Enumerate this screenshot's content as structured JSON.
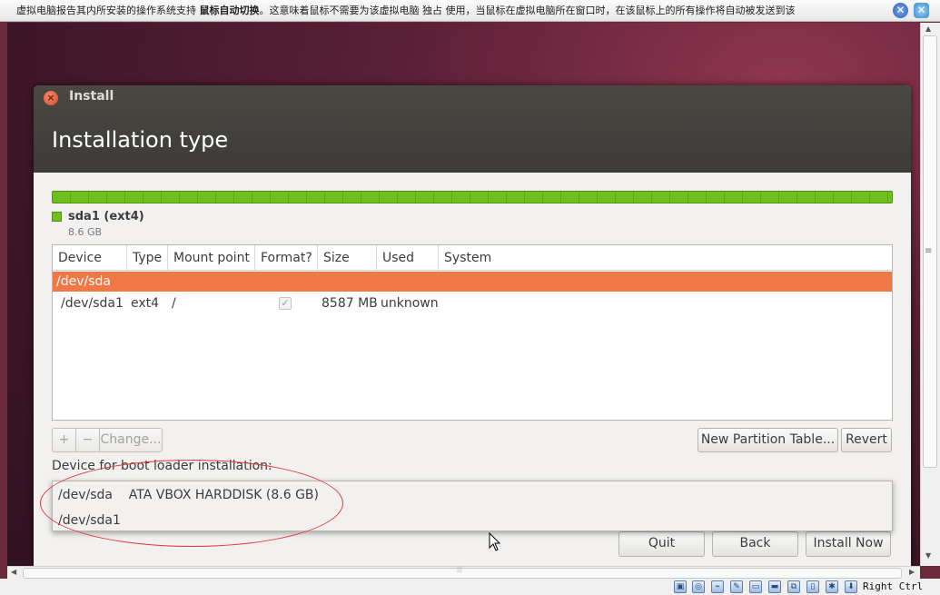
{
  "vbox_notice": {
    "pre": "虚拟电脑报告其内所安装的操作系统支持",
    "bold": "鼠标自动切换",
    "post": "。这意味着鼠标不需要为该虚拟电脑",
    "post2": "独占",
    "post3": "使用，当鼠标在虚拟电脑所在窗口时，在该鼠标上的所有操作将自动被发送到该",
    "close_icon": "close-icon",
    "hide_icon": "hide-icon"
  },
  "window": {
    "title": "Install",
    "heading": "Installation type"
  },
  "partition_bar": {
    "color": "#6fc01d",
    "legend_name": "sda1 (ext4)",
    "legend_size": "8.6 GB"
  },
  "table": {
    "columns": [
      "Device",
      "Type",
      "Mount point",
      "Format?",
      "Size",
      "Used",
      "System"
    ],
    "selected_row": "/dev/sda",
    "rows": [
      {
        "device": "/dev/sda1",
        "type": "ext4",
        "mount": "/",
        "format_checked": true,
        "size": "8587 MB",
        "used": "unknown",
        "system": ""
      }
    ]
  },
  "table_buttons": {
    "add": "+",
    "remove": "−",
    "change": "Change...",
    "new_partition_table": "New Partition Table...",
    "revert": "Revert"
  },
  "boot_loader": {
    "label": "Device for boot loader installation:",
    "options": [
      "/dev/sda    ATA VBOX HARDDISK (8.6 GB)",
      "/dev/sda1"
    ]
  },
  "footer_buttons": {
    "quit": "Quit",
    "back": "Back",
    "install_now": "Install Now"
  },
  "status_bar": {
    "host_key": "Right Ctrl"
  },
  "colors": {
    "accent_selected_row": "#f07746",
    "titlebar": "#3c3b37",
    "annotation_ellipse": "#e23a3a"
  }
}
